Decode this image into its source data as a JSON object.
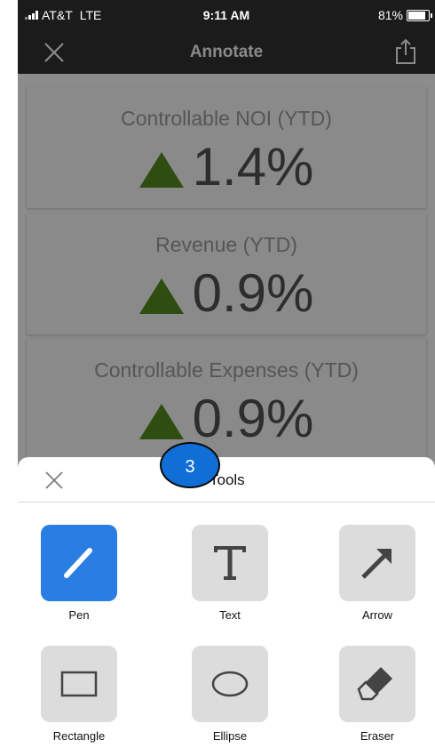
{
  "status_bar": {
    "carrier": "AT&T",
    "network": "LTE",
    "time": "9:11 AM",
    "battery": "81%"
  },
  "nav": {
    "title": "Annotate",
    "close_icon": "close-icon",
    "share_icon": "share-icon"
  },
  "cards": [
    {
      "label": "Controllable NOI (YTD)",
      "value": "1.4%",
      "trend": "up"
    },
    {
      "label": "Revenue (YTD)",
      "value": "0.9%",
      "trend": "up"
    },
    {
      "label": "Controllable Expenses (YTD)",
      "value": "0.9%",
      "trend": "up"
    }
  ],
  "step_badge": "3",
  "tools_sheet": {
    "title": "Tools",
    "tools": [
      {
        "label": "Pen",
        "icon": "pen-icon",
        "selected": true
      },
      {
        "label": "Text",
        "icon": "text-icon",
        "selected": false
      },
      {
        "label": "Arrow",
        "icon": "arrow-icon",
        "selected": false
      },
      {
        "label": "Rectangle",
        "icon": "rectangle-icon",
        "selected": false
      },
      {
        "label": "Ellipse",
        "icon": "ellipse-icon",
        "selected": false
      },
      {
        "label": "Eraser",
        "icon": "eraser-icon",
        "selected": false
      }
    ]
  },
  "colors": {
    "accent": "#2a7de2",
    "trend_up": "#2f4d11",
    "overlay": "#8c8c8c",
    "bar": "#1b1b1b"
  }
}
